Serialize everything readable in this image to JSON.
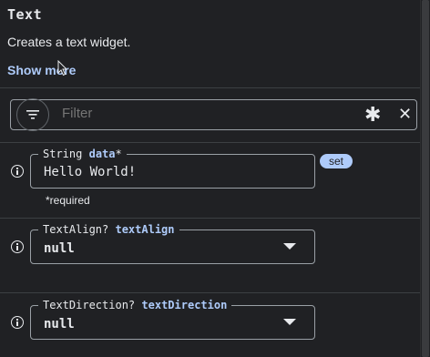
{
  "header": {
    "title": "Text",
    "description": "Creates a text widget.",
    "show_more": "Show more"
  },
  "filter": {
    "placeholder": "Filter",
    "asterisk": "✱",
    "clear": "✕"
  },
  "params": [
    {
      "type": "String",
      "name": "data",
      "required_mark": "*",
      "value": "Hello World!",
      "badge": "set",
      "note": "*required"
    },
    {
      "type": "TextAlign?",
      "name": "textAlign",
      "value": "null"
    },
    {
      "type": "TextDirection?",
      "name": "textDirection",
      "value": "null"
    }
  ]
}
